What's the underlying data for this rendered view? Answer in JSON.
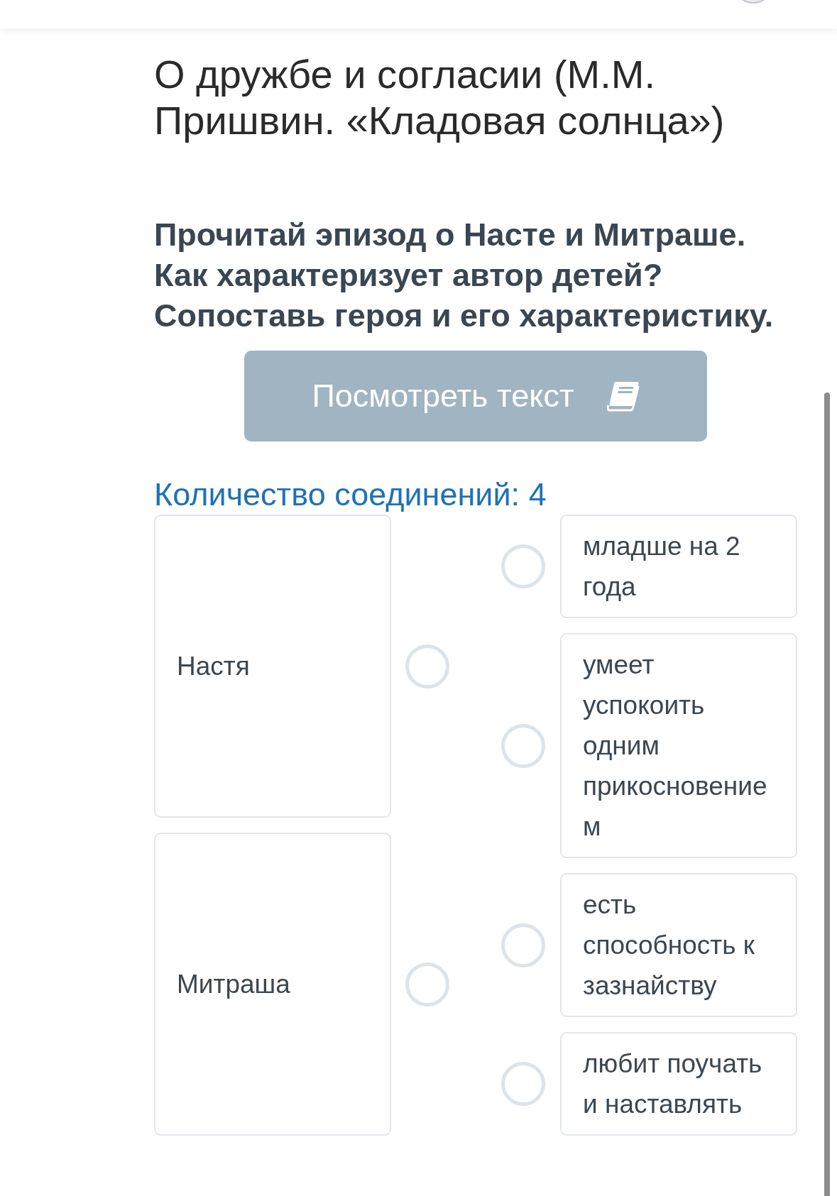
{
  "title": "О дружбе и согласии (М.М. Пришвин. «Кладовая солнца»)",
  "question": "Прочитай эпизод о Насте и Митраше.\nКак характеризует автор детей?\nСопоставь героя и его характеристику.",
  "view_text_button": {
    "label": "Посмотреть текст"
  },
  "connections_label": "Количество соединений: 4",
  "left_items": [
    {
      "label": "Настя"
    },
    {
      "label": "Митраша"
    }
  ],
  "right_items": [
    {
      "label": "младше на 2 года"
    },
    {
      "label": "умеет успокоить одним прикосновением"
    },
    {
      "label": "есть способность к зазнайству"
    },
    {
      "label": "любит поучать и наставлять"
    }
  ]
}
